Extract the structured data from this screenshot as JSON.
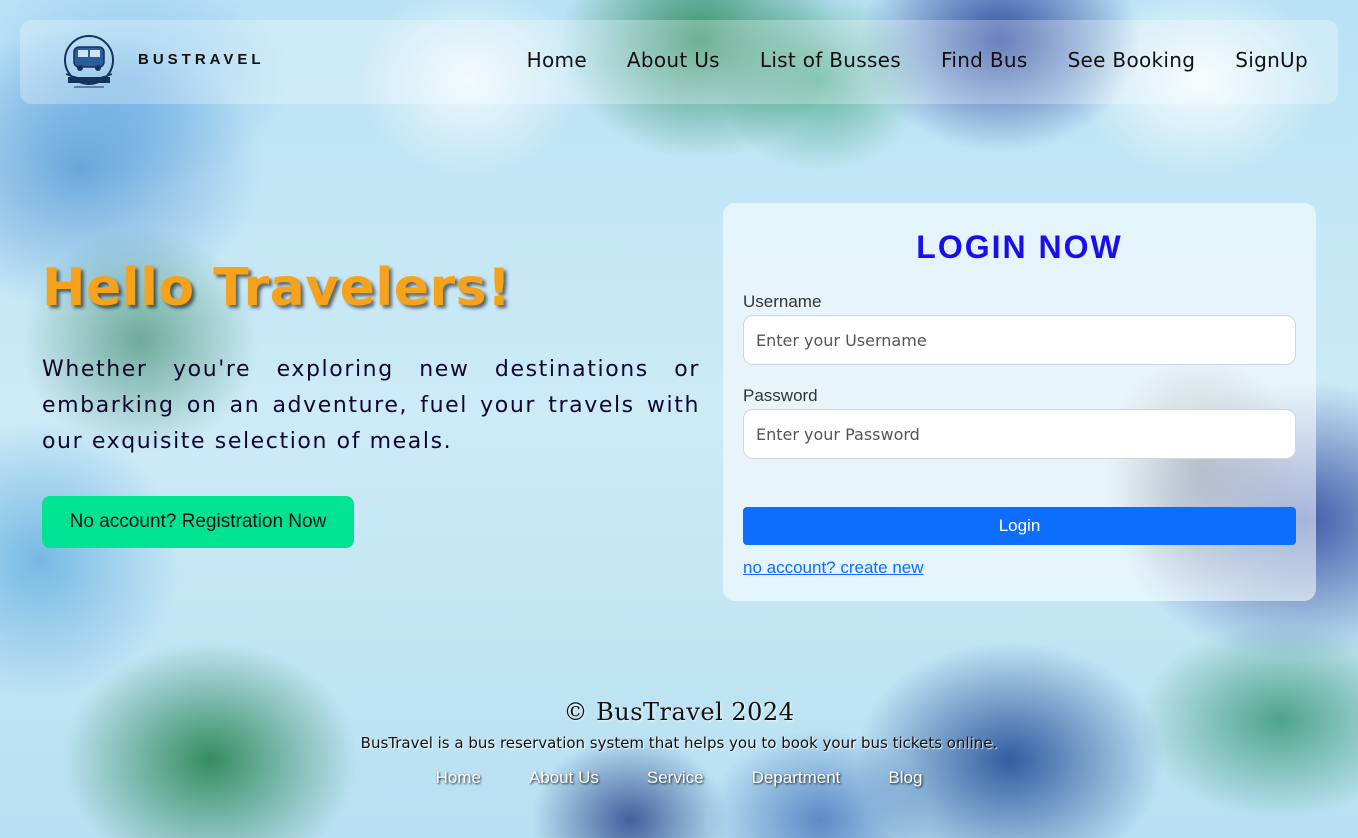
{
  "navbar": {
    "brand": "BUSTRAVEL",
    "logo_icon": "bus-logo-icon",
    "links": [
      "Home",
      "About Us",
      "List of Busses",
      "Find Bus",
      "See Booking",
      "SignUp"
    ]
  },
  "hero": {
    "title": "Hello Travelers!",
    "text": "Whether you're exploring new destinations or embarking on an adventure, fuel your travels with our exquisite selection of meals.",
    "register_button": "No account? Registration Now"
  },
  "login": {
    "title": "LOGIN NOW",
    "username_label": "Username",
    "username_placeholder": "Enter your Username",
    "password_label": "Password",
    "password_placeholder": "Enter your Password",
    "submit_label": "Login",
    "create_link": "no account? create new"
  },
  "footer": {
    "copyright": "© BusTravel 2024",
    "tagline": "BusTravel is a bus reservation system that helps you to book your bus tickets online.",
    "links": [
      "Home",
      "About Us",
      "Service",
      "Department",
      "Blog"
    ]
  },
  "colors": {
    "title_orange": "#f7a21b",
    "login_title_blue": "#1a0dee",
    "button_green": "#00e392",
    "button_blue": "#0d6efd"
  }
}
